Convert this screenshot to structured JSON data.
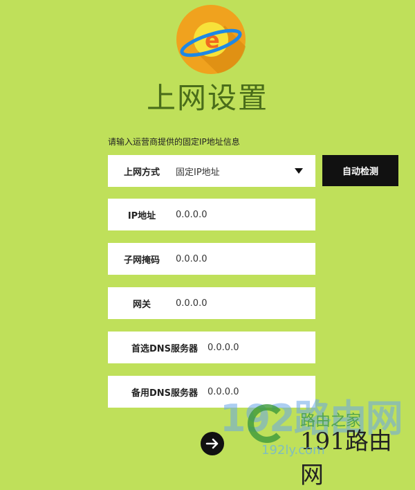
{
  "page": {
    "title": "上网设置",
    "hint": "请输入运营商提供的固定IP地址信息"
  },
  "connection": {
    "label": "上网方式",
    "selected": "固定IP地址",
    "detect_button": "自动检测"
  },
  "fields": {
    "ip": {
      "label": "IP地址",
      "value": "0.0.0.0"
    },
    "mask": {
      "label": "子网掩码",
      "value": "0.0.0.0"
    },
    "gateway": {
      "label": "网关",
      "value": "0.0.0.0"
    },
    "dns1": {
      "label": "首选DNS服务器",
      "value": "0.0.0.0"
    },
    "dns2": {
      "label": "备用DNS服务器",
      "value": "0.0.0.0"
    }
  },
  "watermark": {
    "big": "192路由网",
    "line1": "路由之家",
    "line2": "191路由网",
    "url": "192ly.com"
  },
  "colors": {
    "background": "#bfe05a",
    "title": "#4a6d1a",
    "logo_orange": "#f0a21e",
    "button_black": "#111111"
  },
  "icons": {
    "logo": "browser-e-planet-icon",
    "dropdown": "caret-down-icon",
    "next": "arrow-right-icon"
  }
}
